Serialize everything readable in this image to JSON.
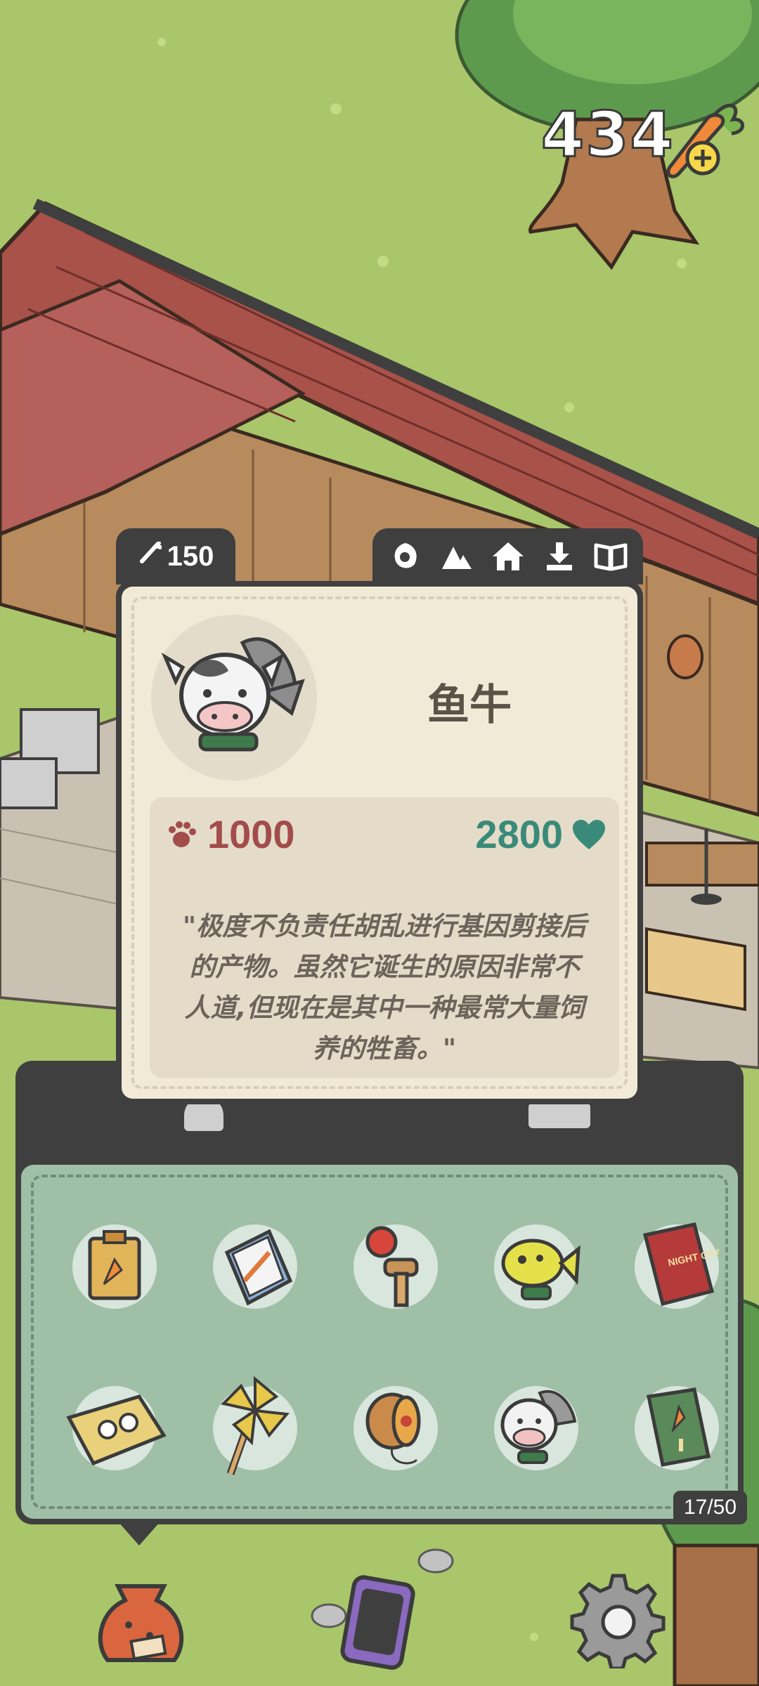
{
  "currency": {
    "carrots": "434",
    "add_icon": "plus-icon"
  },
  "card": {
    "cost": "150",
    "cost_icon": "carrot-icon",
    "actions": [
      {
        "name": "feed",
        "icon": "leaf-icon"
      },
      {
        "name": "mountains",
        "icon": "mountain-icon"
      },
      {
        "name": "home",
        "icon": "home-icon"
      },
      {
        "name": "download",
        "icon": "download-icon"
      },
      {
        "name": "book",
        "icon": "book-icon"
      }
    ],
    "animal_name": "鱼牛",
    "stat_left": "1000",
    "stat_left_icon": "paw-icon",
    "stat_right": "2800",
    "stat_right_icon": "heart-icon",
    "description_lines": [
      "\"极度不负责任胡乱进行基因剪接后",
      "的产物。虽然它诞生的原因非常不",
      "人道,但现在是其中一种最常大量饲",
      "养的牲畜。\""
    ]
  },
  "inventory": {
    "count": "17/50",
    "items": [
      {
        "name": "seed-packet"
      },
      {
        "name": "notebook"
      },
      {
        "name": "kendama"
      },
      {
        "name": "yellow-fish"
      },
      {
        "name": "night-crawlers-book",
        "label": "NIGHT CRAWLERS"
      },
      {
        "name": "cassette"
      },
      {
        "name": "pinwheel"
      },
      {
        "name": "yoyo"
      },
      {
        "name": "fish-cow"
      },
      {
        "name": "carrot-book"
      }
    ]
  },
  "colors": {
    "panel": "#3f3f3f",
    "card_bg": "#f1ead6",
    "inv_bg": "#9fbfa6",
    "stat_red": "#a24c4c",
    "stat_teal": "#3a8a79"
  },
  "nav": [
    {
      "name": "bag",
      "icon": "bag-icon"
    },
    {
      "name": "phone",
      "icon": "phone-icon"
    },
    {
      "name": "settings",
      "icon": "gear-icon"
    }
  ]
}
